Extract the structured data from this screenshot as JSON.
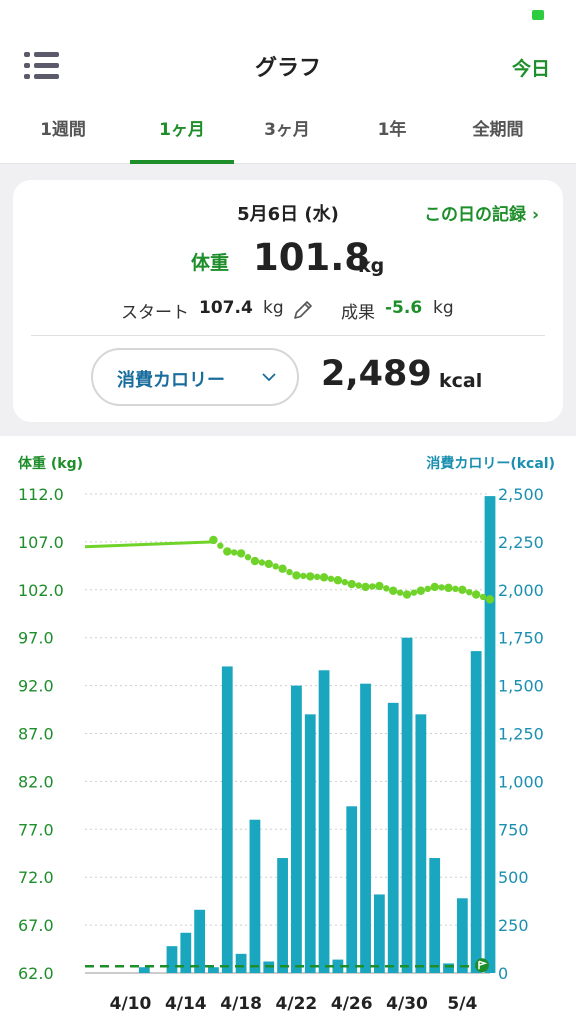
{
  "nav": {
    "title": "グラフ",
    "today_label": "今日"
  },
  "tabs": [
    {
      "label": "1週間",
      "active": false
    },
    {
      "label": "1ヶ月",
      "active": true
    },
    {
      "label": "3ヶ月",
      "active": false
    },
    {
      "label": "1年",
      "active": false
    },
    {
      "label": "全期間",
      "active": false
    }
  ],
  "summary": {
    "date": "5月6日 (水)",
    "record_link": "この日の記録 ›",
    "weight_label": "体重",
    "weight_value": "101.8",
    "weight_unit": "kg",
    "start_label": "スタート",
    "start_value": "107.4",
    "start_unit": "kg",
    "result_label": "成果",
    "result_value": "-5.6",
    "result_unit": "kg",
    "calorie_selector": "消費カロリー",
    "calorie_value": "2,489",
    "calorie_unit": "kcal"
  },
  "colors": {
    "accent_green": "#1e8e2a",
    "weight_line": "#6fd32a",
    "bar_teal": "#1aa6be",
    "calorie_axis": "#1a8fb0"
  },
  "chart_data": {
    "type": "bar",
    "left_axis_label": "体重 (kg)",
    "right_axis_label": "消費カロリー(kcal)",
    "left_ticks": [
      "112.0",
      "107.0",
      "102.0",
      "97.0",
      "92.0",
      "87.0",
      "82.0",
      "77.0",
      "72.0",
      "67.0",
      "62.0"
    ],
    "right_ticks": [
      "2,500",
      "2,250",
      "2,000",
      "1,750",
      "1,500",
      "1,250",
      "1,000",
      "750",
      "500",
      "250",
      "0"
    ],
    "x_labels": [
      "4/10",
      "4/14",
      "4/18",
      "4/22",
      "4/26",
      "4/30",
      "5/4"
    ],
    "ylim_left": [
      62,
      112
    ],
    "ylim_right": [
      0,
      2500
    ],
    "calorie_series": {
      "name": "消費カロリー",
      "dates": [
        "4/7",
        "4/8",
        "4/9",
        "4/10",
        "4/11",
        "4/12",
        "4/13",
        "4/14",
        "4/15",
        "4/16",
        "4/17",
        "4/18",
        "4/19",
        "4/20",
        "4/21",
        "4/22",
        "4/23",
        "4/24",
        "4/25",
        "4/26",
        "4/27",
        "4/28",
        "4/29",
        "4/30",
        "5/1",
        "5/2",
        "5/3",
        "5/4",
        "5/5",
        "5/6"
      ],
      "values": [
        0,
        0,
        0,
        0,
        30,
        0,
        140,
        210,
        330,
        30,
        1600,
        100,
        800,
        60,
        600,
        1500,
        1350,
        1580,
        70,
        870,
        1510,
        410,
        1410,
        1750,
        1350,
        600,
        50,
        390,
        1680,
        2489
      ]
    },
    "weight_series": {
      "name": "体重",
      "solid": [
        {
          "date": "4/7",
          "value": 106.5
        },
        {
          "date": "4/16",
          "value": 107.0
        }
      ],
      "dotted": [
        {
          "date": "4/16",
          "value": 107.2
        },
        {
          "date": "4/17",
          "value": 106.0
        },
        {
          "date": "4/18",
          "value": 105.8
        },
        {
          "date": "4/19",
          "value": 105.0
        },
        {
          "date": "4/20",
          "value": 104.7
        },
        {
          "date": "4/21",
          "value": 104.2
        },
        {
          "date": "4/22",
          "value": 103.5
        },
        {
          "date": "4/23",
          "value": 103.4
        },
        {
          "date": "4/24",
          "value": 103.3
        },
        {
          "date": "4/25",
          "value": 103.0
        },
        {
          "date": "4/26",
          "value": 102.6
        },
        {
          "date": "4/27",
          "value": 102.3
        },
        {
          "date": "4/28",
          "value": 102.4
        },
        {
          "date": "4/29",
          "value": 101.9
        },
        {
          "date": "4/30",
          "value": 101.5
        },
        {
          "date": "5/1",
          "value": 101.9
        },
        {
          "date": "5/2",
          "value": 102.3
        },
        {
          "date": "5/3",
          "value": 102.2
        },
        {
          "date": "5/4",
          "value": 102.0
        },
        {
          "date": "5/5",
          "value": 101.5
        },
        {
          "date": "5/6",
          "value": 101.0
        }
      ]
    },
    "goal_line": {
      "value": 62.7,
      "style": "dashed"
    }
  }
}
